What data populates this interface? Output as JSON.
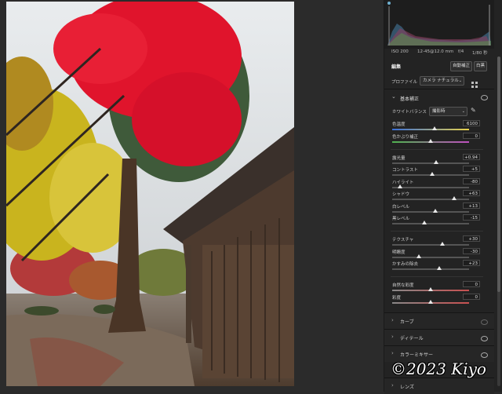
{
  "camera": {
    "iso": "ISO 200",
    "lens": "12-45@12.0 mm",
    "aperture": "f/4",
    "shutter": "1/80 秒"
  },
  "edit": {
    "title": "編集",
    "auto_label": "自動補正",
    "bw_label": "白黒"
  },
  "profile": {
    "label": "プロファイル",
    "value": "カメラ ナチュラル"
  },
  "basic": {
    "title": "基本補正",
    "wb_label": "ホワイトバランス",
    "wb_value": "撮影時",
    "sliders": [
      {
        "name": "色温度",
        "value": "6100",
        "pos": 0.55
      },
      {
        "name": "色かぶり補正",
        "value": "0",
        "pos": 0.5
      },
      {
        "name": "露光量",
        "value": "+0.94",
        "pos": 0.57
      },
      {
        "name": "コントラスト",
        "value": "+5",
        "pos": 0.52
      },
      {
        "name": "ハイライト",
        "value": "-80",
        "pos": 0.1
      },
      {
        "name": "シャドウ",
        "value": "+63",
        "pos": 0.81
      },
      {
        "name": "白レベル",
        "value": "+13",
        "pos": 0.56
      },
      {
        "name": "黒レベル",
        "value": "-15",
        "pos": 0.42
      },
      {
        "name": "テクスチャ",
        "value": "+30",
        "pos": 0.65
      },
      {
        "name": "明瞭度",
        "value": "-30",
        "pos": 0.35
      },
      {
        "name": "かすみの除去",
        "value": "+23",
        "pos": 0.61
      },
      {
        "name": "自然な彩度",
        "value": "0",
        "pos": 0.5
      },
      {
        "name": "彩度",
        "value": "0",
        "pos": 0.5
      }
    ]
  },
  "sections": [
    "カーブ",
    "ディテール",
    "カラーミキサー",
    "レンズ"
  ],
  "watermark": "©2023 Kiyo"
}
